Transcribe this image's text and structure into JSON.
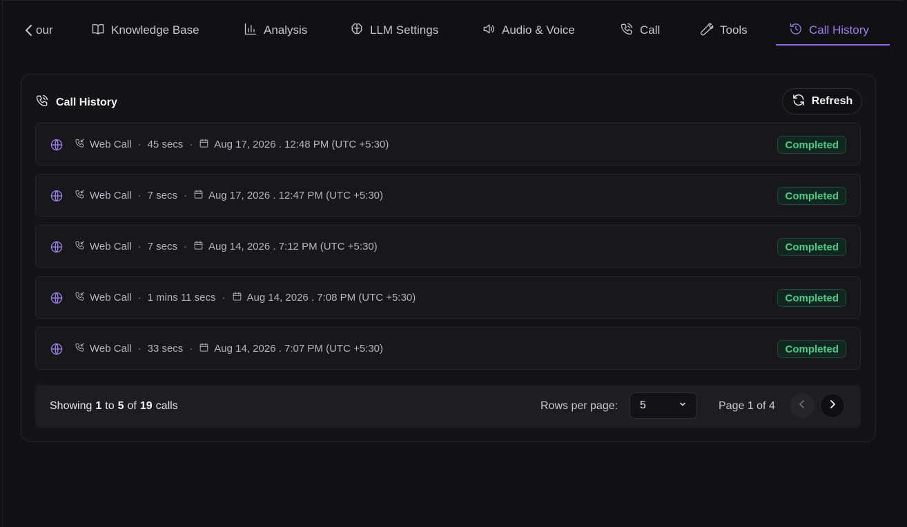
{
  "tabs": [
    {
      "label": "our",
      "icon": "chevron-left-icon"
    },
    {
      "label": "Knowledge Base",
      "icon": "book-icon"
    },
    {
      "label": "Analysis",
      "icon": "bar-chart-icon"
    },
    {
      "label": "LLM Settings",
      "icon": "brain-icon"
    },
    {
      "label": "Audio & Voice",
      "icon": "speaker-icon"
    },
    {
      "label": "Call",
      "icon": "phone-icon"
    },
    {
      "label": "Tools",
      "icon": "wrench-icon"
    },
    {
      "label": "Call History",
      "icon": "history-icon",
      "active": true
    }
  ],
  "panel": {
    "title": "Call History",
    "refresh_label": "Refresh"
  },
  "calls": [
    {
      "type": "Web Call",
      "duration": "45 secs",
      "datetime": "Aug 17, 2026 . 12:48 PM (UTC +5:30)",
      "status": "Completed"
    },
    {
      "type": "Web Call",
      "duration": "7 secs",
      "datetime": "Aug 17, 2026 . 12:47 PM (UTC +5:30)",
      "status": "Completed"
    },
    {
      "type": "Web Call",
      "duration": "7 secs",
      "datetime": "Aug 14, 2026 . 7:12 PM (UTC +5:30)",
      "status": "Completed"
    },
    {
      "type": "Web Call",
      "duration": "1 mins 11 secs",
      "datetime": "Aug 14, 2026 . 7:08 PM (UTC +5:30)",
      "status": "Completed"
    },
    {
      "type": "Web Call",
      "duration": "33 secs",
      "datetime": "Aug 14, 2026 . 7:07 PM (UTC +5:30)",
      "status": "Completed"
    }
  ],
  "pagination": {
    "showing_prefix": "Showing",
    "from": "1",
    "to_word": "to",
    "to": "5",
    "of_word": "of",
    "total": "19",
    "unit": "calls",
    "rows_label": "Rows per page:",
    "rows_value": "5",
    "page_label": "Page 1 of 4"
  },
  "colors": {
    "accent": "#8b6cf0",
    "success": "#3fd08b",
    "background": "#111113"
  }
}
